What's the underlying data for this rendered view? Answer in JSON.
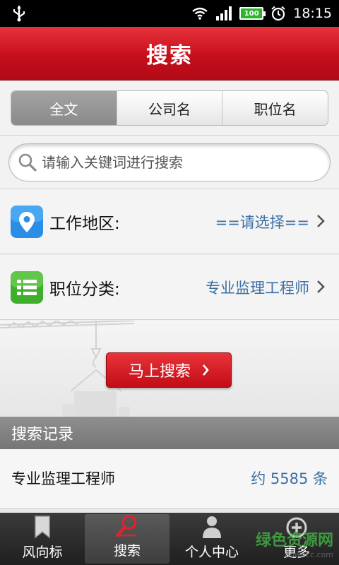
{
  "status_bar": {
    "time": "18:15",
    "battery": "100"
  },
  "header": {
    "title": "搜索"
  },
  "tabs": [
    {
      "label": "全文",
      "active": true
    },
    {
      "label": "公司名",
      "active": false
    },
    {
      "label": "职位名",
      "active": false
    }
  ],
  "search": {
    "placeholder": "请输入关键词进行搜索"
  },
  "filters": {
    "location": {
      "label": "工作地区:",
      "value": "==请选择=="
    },
    "category": {
      "label": "职位分类:",
      "value": "专业监理工程师"
    }
  },
  "go_button": {
    "label": "马上搜索"
  },
  "history": {
    "title": "搜索记录",
    "items": [
      {
        "term": "专业监理工程师",
        "count": "约 5585 条"
      }
    ]
  },
  "bottom_nav": [
    {
      "label": "风向标",
      "icon": "bookmark-icon",
      "active": false
    },
    {
      "label": "搜索",
      "icon": "search-icon",
      "active": true
    },
    {
      "label": "个人中心",
      "icon": "person-icon",
      "active": false
    },
    {
      "label": "更多",
      "icon": "plus-circle-icon",
      "active": false
    }
  ],
  "watermark": {
    "text": "绿色资源网",
    "sub": "downcc.com"
  },
  "colors": {
    "header_red": "#c50f1c",
    "link_blue": "#3c6ea5",
    "location_icon": "#2a8ee6",
    "category_icon": "#44b52e"
  }
}
